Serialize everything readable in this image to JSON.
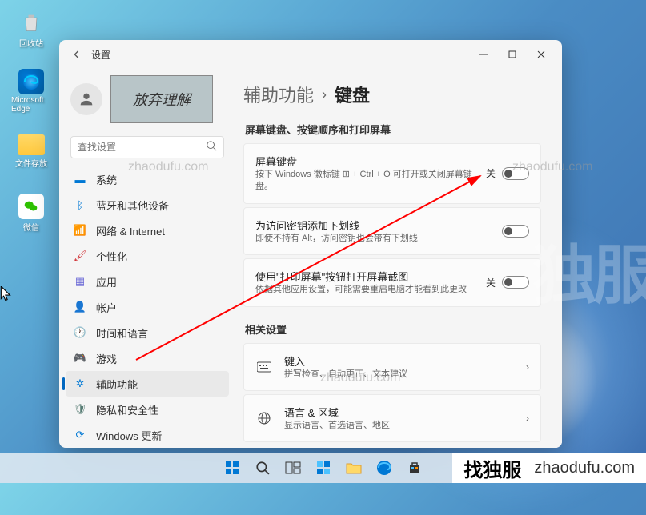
{
  "desktop": {
    "recycle": "回收站",
    "edge": "Microsoft Edge",
    "folder": "文件存放",
    "wechat": "微信"
  },
  "window": {
    "title": "设置",
    "search_placeholder": "查找设置"
  },
  "user": {
    "handwriting": "放弃理解"
  },
  "nav": {
    "system": "系统",
    "bluetooth": "蓝牙和其他设备",
    "network": "网络 & Internet",
    "personalize": "个性化",
    "apps": "应用",
    "accounts": "帐户",
    "time": "时间和语言",
    "gaming": "游戏",
    "accessibility": "辅助功能",
    "privacy": "隐私和安全性",
    "update": "Windows 更新"
  },
  "breadcrumb": {
    "parent": "辅助功能",
    "current": "键盘"
  },
  "section1_title": "屏幕键盘、按键顺序和打印屏幕",
  "cards": {
    "osk": {
      "title": "屏幕键盘",
      "desc": "按下 Windows 徽标键 ⊞ + Ctrl + O 可打开或关闭屏幕键盘。",
      "state": "关"
    },
    "underline": {
      "title": "为访问密钥添加下划线",
      "desc": "即使不持有 Alt，访问密钥也会带有下划线"
    },
    "prtsc": {
      "title": "使用\"打印屏幕\"按钮打开屏幕截图",
      "desc": "依据其他应用设置，可能需要重启电脑才能看到此更改",
      "state": "关"
    }
  },
  "related_title": "相关设置",
  "related": {
    "typing": {
      "title": "键入",
      "desc": "拼写检查、自动更正、文本建议"
    },
    "lang": {
      "title": "语言 & 区域",
      "desc": "显示语言、首选语言、地区"
    }
  },
  "watermarks": {
    "w1": "zhaodufu.com",
    "w2": "zhaodufu.com",
    "w3": "zhaodufu.com"
  },
  "banner": {
    "text1": "找独服",
    "text2": "zhaodufu.com"
  }
}
